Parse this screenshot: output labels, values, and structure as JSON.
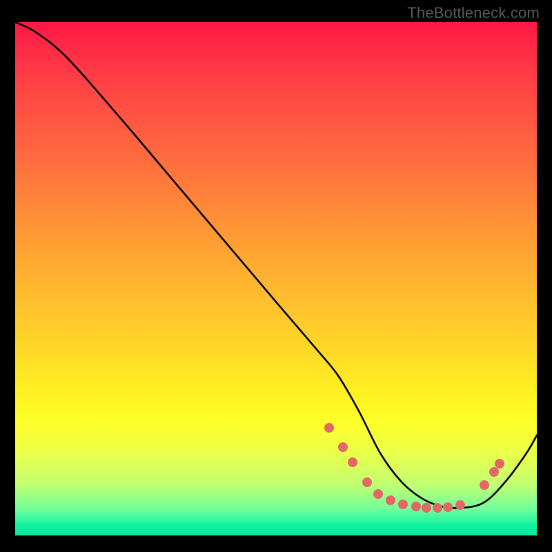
{
  "watermark": "TheBottleneck.com",
  "chart_data": {
    "type": "line",
    "title": "",
    "xlabel": "",
    "ylabel": "",
    "xlim": [
      0,
      100
    ],
    "ylim": [
      0,
      100
    ],
    "grid": false,
    "legend": false,
    "series": [
      {
        "name": "curve",
        "color": "#000000",
        "x": [
          0,
          4,
          10,
          20,
          30,
          40,
          50,
          58,
          62,
          66,
          70,
          74,
          78,
          82,
          86,
          90,
          94,
          98,
          100
        ],
        "y": [
          100,
          98,
          93,
          81.5,
          69.5,
          57.5,
          45.5,
          36,
          31,
          24,
          16,
          10.5,
          7.2,
          5.6,
          5.4,
          6.5,
          10.5,
          16,
          19.5
        ]
      }
    ],
    "markers": [
      {
        "x": 60.2,
        "y": 21.0
      },
      {
        "x": 62.8,
        "y": 17.2
      },
      {
        "x": 64.7,
        "y": 14.3
      },
      {
        "x": 67.4,
        "y": 10.4
      },
      {
        "x": 69.6,
        "y": 8.0
      },
      {
        "x": 72.0,
        "y": 6.8
      },
      {
        "x": 74.4,
        "y": 6.1
      },
      {
        "x": 76.8,
        "y": 5.6
      },
      {
        "x": 78.8,
        "y": 5.4
      },
      {
        "x": 80.9,
        "y": 5.4
      },
      {
        "x": 83.0,
        "y": 5.5
      },
      {
        "x": 85.3,
        "y": 5.9
      },
      {
        "x": 90.0,
        "y": 9.8
      },
      {
        "x": 91.8,
        "y": 12.4
      },
      {
        "x": 92.8,
        "y": 14.0
      }
    ],
    "marker_color": "#e26765",
    "background_gradient": {
      "top": "#ff1744",
      "mid": "#ffd429",
      "bottom": "#09e89e"
    }
  }
}
